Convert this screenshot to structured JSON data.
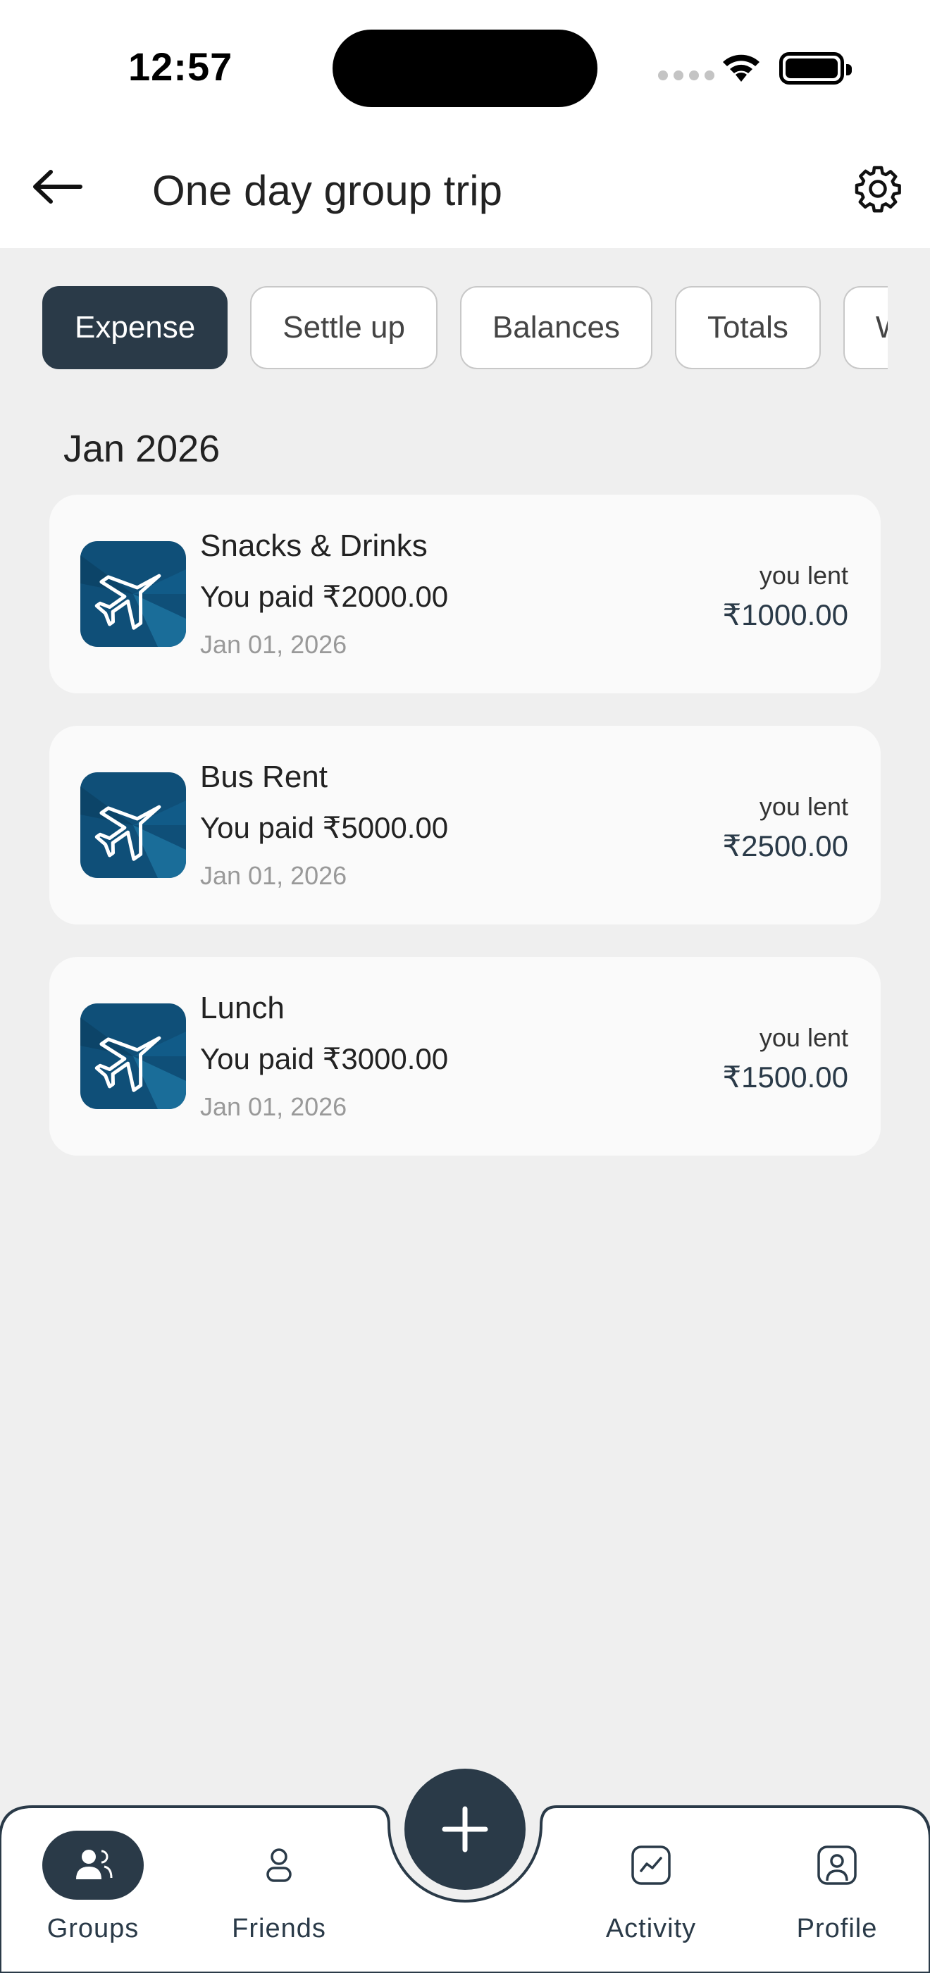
{
  "status_bar": {
    "time": "12:57"
  },
  "header": {
    "title": "One day group trip",
    "back_icon": "arrow-left-icon",
    "settings_icon": "gear-icon"
  },
  "tabs": [
    {
      "label": "Expense",
      "active": true
    },
    {
      "label": "Settle up",
      "active": false
    },
    {
      "label": "Balances",
      "active": false
    },
    {
      "label": "Totals",
      "active": false
    },
    {
      "label": "W",
      "active": false
    }
  ],
  "month_header": "Jan 2026",
  "expenses": [
    {
      "title": "Snacks & Drinks",
      "paid": "You paid ₹2000.00",
      "date": "Jan 01, 2026",
      "lent_label": "you lent",
      "lent_amount": "₹1000.00",
      "icon": "airplane-icon"
    },
    {
      "title": "Bus Rent",
      "paid": "You paid ₹5000.00",
      "date": "Jan 01, 2026",
      "lent_label": "you lent",
      "lent_amount": "₹2500.00",
      "icon": "airplane-icon"
    },
    {
      "title": "Lunch",
      "paid": "You paid ₹3000.00",
      "date": "Jan 01, 2026",
      "lent_label": "you lent",
      "lent_amount": "₹1500.00",
      "icon": "airplane-icon"
    }
  ],
  "bottom_nav": {
    "items": [
      {
        "label": "Groups",
        "icon": "groups-icon",
        "active": true
      },
      {
        "label": "Friends",
        "icon": "person-icon",
        "active": false
      },
      {
        "label": "Activity",
        "icon": "activity-icon",
        "active": false
      },
      {
        "label": "Profile",
        "icon": "profile-icon",
        "active": false
      }
    ],
    "fab_icon": "plus-icon"
  },
  "colors": {
    "accent": "#2a3a48",
    "background": "#efefef",
    "card": "#fafafa",
    "icon_bg": "#0f4f78"
  }
}
